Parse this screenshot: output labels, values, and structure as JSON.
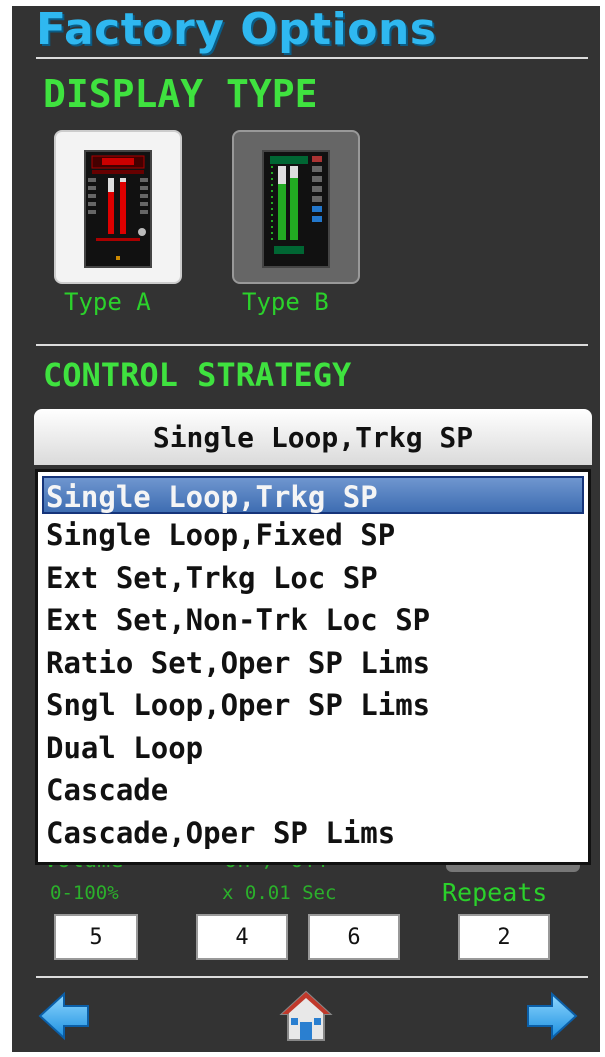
{
  "header": {
    "title": "Factory Options"
  },
  "display_type": {
    "heading": "DISPLAY TYPE",
    "types": [
      {
        "label": "Type A"
      },
      {
        "label": "Type B"
      }
    ]
  },
  "control_strategy": {
    "heading": "CONTROL STRATEGY",
    "selected": "Single Loop,Trkg SP",
    "options": [
      "Single Loop,Trkg SP",
      "Single Loop,Fixed SP",
      "Ext Set,Trkg Loc SP",
      "Ext Set,Non-Trk Loc SP",
      "Ratio Set,Oper SP Lims",
      "Sngl Loop,Oper SP Lims",
      "Dual Loop",
      "Cascade",
      "Cascade,Oper SP Lims"
    ]
  },
  "alarm": {
    "volume_label": "Volume",
    "volume_range": "0-100%",
    "onoff_label": "On / Off",
    "onoff_unit": "x 0.01 Sec",
    "repeats_label": "Repeats",
    "volume_value": "5",
    "on_value": "4",
    "off_value": "6",
    "repeats_value": "2"
  },
  "nav": {
    "icons": [
      "arrow-left-icon",
      "home-icon",
      "arrow-right-icon"
    ]
  },
  "colors": {
    "title": "#2fb8f0",
    "heading": "#3fe23f",
    "label": "#2bb02b",
    "background": "#333333",
    "selection": "#4a78bd"
  }
}
